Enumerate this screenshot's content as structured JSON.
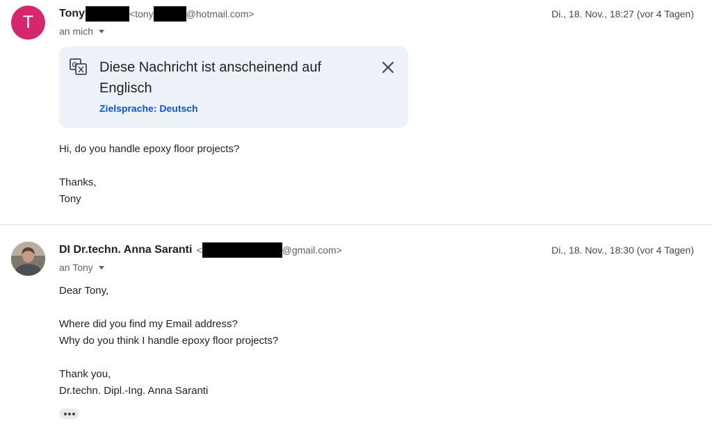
{
  "messages": [
    {
      "avatar_initial": "T",
      "sender_name": "Tony",
      "email_prefix": "<tony",
      "email_suffix": "@hotmail.com>",
      "timestamp": "Di., 18. Nov., 18:27 (vor 4 Tagen)",
      "recipient": "an mich",
      "translation": {
        "title": "Diese Nachricht ist anscheinend auf Englisch",
        "target_language": "Zielsprache: Deutsch"
      },
      "body": [
        "Hi, do you handle epoxy floor projects?",
        "",
        "Thanks,",
        "Tony"
      ]
    },
    {
      "sender_name": "DI Dr.techn. Anna Saranti",
      "email_prefix": "<",
      "email_suffix": "@gmail.com>",
      "timestamp": "Di., 18. Nov., 18:30 (vor 4 Tagen)",
      "recipient": "an Tony",
      "body": [
        "Dear Tony,",
        "",
        "Where did you find my Email address?",
        "Why do you think I handle epoxy floor projects?",
        "",
        "Thank you,",
        "Dr.techn. Dipl.-Ing. Anna Saranti"
      ]
    }
  ],
  "colors": {
    "avatar_bg": "#d6266e",
    "banner_bg": "#edf1f8",
    "link_blue": "#0b57d0"
  },
  "icons": {
    "translate": "translate-icon",
    "close": "close-icon",
    "recipient_caret": "caret-down-icon",
    "more": "more-horizontal-icon"
  }
}
